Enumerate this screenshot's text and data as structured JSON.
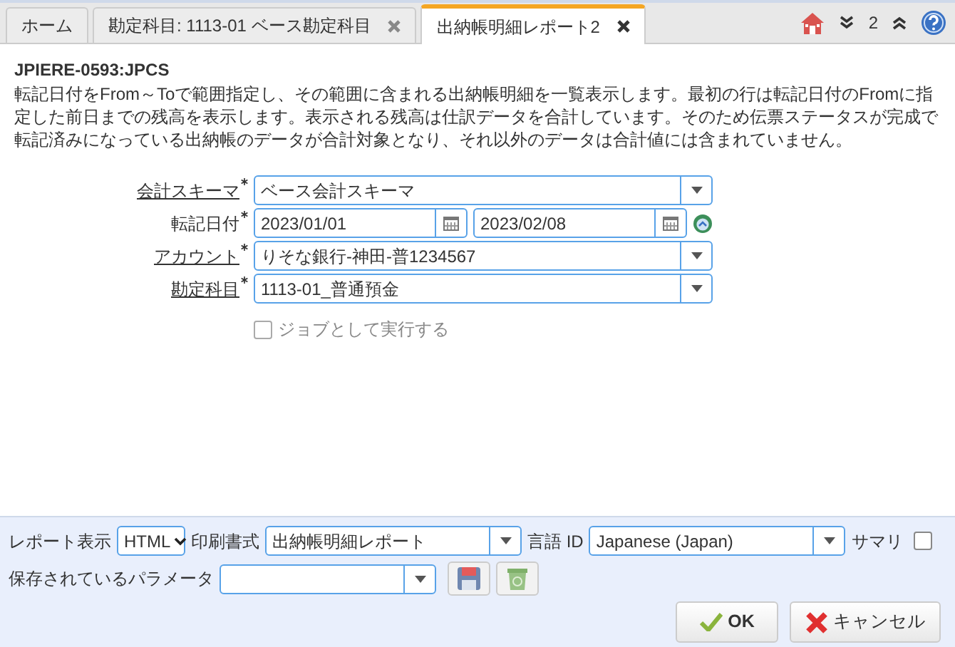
{
  "tabs": [
    {
      "label": "ホーム",
      "closable": false,
      "selected": false
    },
    {
      "label": "勘定科目: 1113-01 ベース勘定科目",
      "closable": true,
      "selected": false
    },
    {
      "label": "出納帳明細レポート2",
      "closable": true,
      "selected": true
    }
  ],
  "toolbar": {
    "count": "2"
  },
  "process": {
    "title": "JPIERE-0593:JPCS",
    "description": "転記日付をFrom～Toで範囲指定し、その範囲に含まれる出納帳明細を一覧表示します。最初の行は転記日付のFromに指定した前日までの残高を表示します。表示される残高は仕訳データを合計しています。そのため伝票ステータスが完成で転記済みになっている出納帳のデータが合計対象となり、それ以外のデータは合計値には含まれていません。"
  },
  "fields": [
    {
      "kind": "select",
      "label": "会計スキーマ",
      "link": true,
      "required": true,
      "value": "ベース会計スキーマ"
    },
    {
      "kind": "daterange",
      "label": "転記日付",
      "link": false,
      "required": true,
      "from": "2023/01/01",
      "to": "2023/02/08"
    },
    {
      "kind": "select",
      "label": "アカウント",
      "link": true,
      "required": true,
      "value": "りそな銀行-神田-普1234567"
    },
    {
      "kind": "select",
      "label": "勘定科目",
      "link": true,
      "required": true,
      "value": "1113-01_普通預金"
    }
  ],
  "run_as_job": {
    "label": "ジョブとして実行する",
    "checked": false,
    "disabled": true
  },
  "footer": {
    "report_label": "レポート表示",
    "report_value": "HTML",
    "format_label": "印刷書式",
    "format_value": "出納帳明細レポート",
    "language_label": "言語 ID",
    "language_value": "Japanese (Japan)",
    "summary_label": "サマリ",
    "summary_checked": false,
    "saved_label": "保存されているパラメータ"
  },
  "buttons": [
    {
      "kind": "ok",
      "label": "OK"
    },
    {
      "kind": "cancel",
      "label": "キャンセル"
    }
  ]
}
